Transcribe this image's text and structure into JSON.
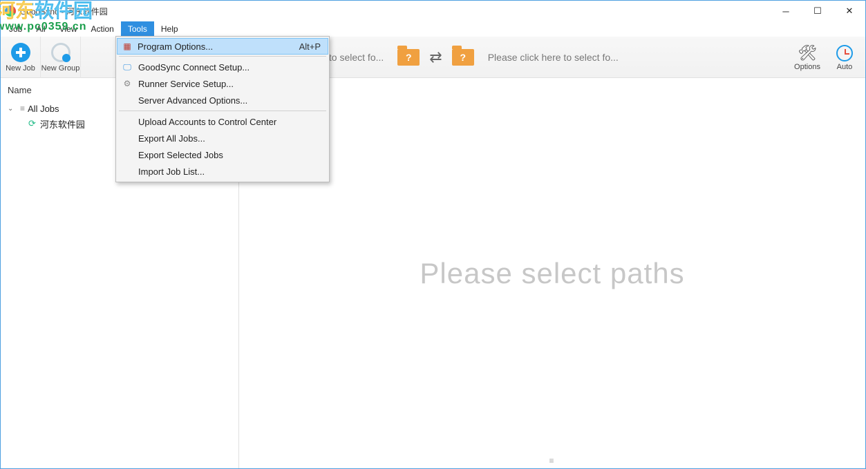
{
  "title": "GoodSync - 河东软件园",
  "watermark": {
    "line1": "河东软件园",
    "line2": "www.pc0359.cn"
  },
  "menubar": [
    "Job",
    "All",
    "View",
    "Action",
    "Tools",
    "Help"
  ],
  "active_menu_index": 4,
  "toolbar": {
    "new_job": "New Job",
    "new_group": "New Group",
    "left_path_placeholder": "Please click here to select fo...",
    "right_path_placeholder": "Please click here to select fo...",
    "options": "Options",
    "auto": "Auto"
  },
  "dropdown": {
    "items": [
      {
        "label": "Program Options...",
        "shortcut": "Alt+P",
        "icon": "options",
        "highlight": true
      },
      {
        "sep": true
      },
      {
        "label": "GoodSync Connect Setup...",
        "icon": "monitor"
      },
      {
        "label": "Runner Service Setup...",
        "icon": "gear"
      },
      {
        "label": "Server Advanced Options..."
      },
      {
        "sep": true
      },
      {
        "label": "Upload Accounts to Control Center"
      },
      {
        "label": "Export All Jobs..."
      },
      {
        "label": "Export Selected Jobs"
      },
      {
        "label": "Import Job List..."
      }
    ]
  },
  "sidebar": {
    "header": "Name",
    "root": "All Jobs",
    "job": "河东软件园"
  },
  "main": {
    "placeholder": "Please select paths"
  }
}
